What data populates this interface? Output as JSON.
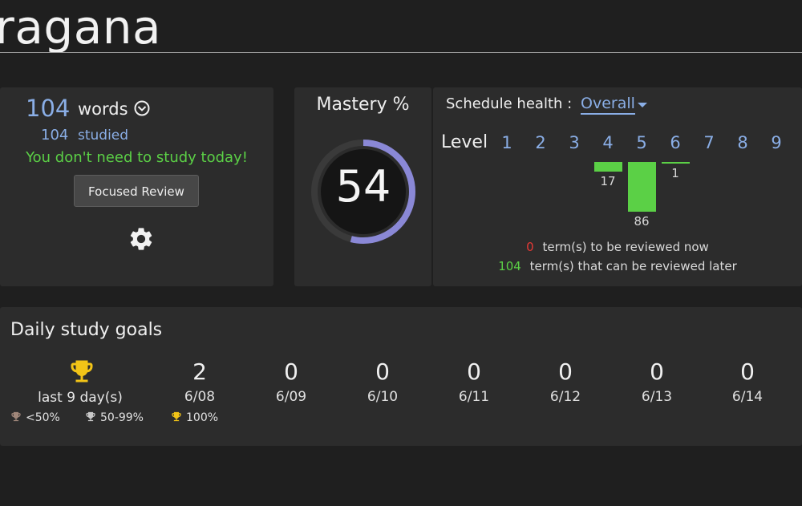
{
  "app_title": "ragana",
  "words_panel": {
    "word_count": "104",
    "word_label": "words",
    "studied_count": "104",
    "studied_label": "studied",
    "status_message": "You don't need to study today!",
    "focused_review_label": "Focused Review",
    "settings_icon": "gear-icon",
    "dropdown_icon": "chevron-down-circle-icon"
  },
  "mastery_panel": {
    "title": "Mastery %",
    "value": "54",
    "percent": 54
  },
  "schedule_panel": {
    "label": "Schedule health :",
    "selected_view": "Overall",
    "level_label": "Level",
    "levels": [
      "1",
      "2",
      "3",
      "4",
      "5",
      "6",
      "7",
      "8",
      "9"
    ],
    "level_counts": [
      0,
      0,
      0,
      17,
      86,
      1,
      0,
      0,
      0
    ],
    "bar_labels": {
      "4": "17",
      "5": "86",
      "6": "1"
    },
    "review_now_count": "0",
    "review_now_text": "term(s) to be reviewed now",
    "review_later_count": "104",
    "review_later_text": "term(s) that can be reviewed later"
  },
  "goals_panel": {
    "title": "Daily study goals",
    "streak_text": "last 9 day(s)",
    "legend": [
      {
        "label": "<50%",
        "color": "#a0877a"
      },
      {
        "label": "50-99%",
        "color": "#c9c9c9"
      },
      {
        "label": "100%",
        "color": "#f2c417"
      }
    ],
    "days": [
      {
        "value": "2",
        "date": "6/08"
      },
      {
        "value": "0",
        "date": "6/09"
      },
      {
        "value": "0",
        "date": "6/10"
      },
      {
        "value": "0",
        "date": "6/11"
      },
      {
        "value": "0",
        "date": "6/12"
      },
      {
        "value": "0",
        "date": "6/13"
      },
      {
        "value": "0",
        "date": "6/14"
      }
    ]
  },
  "colors": {
    "accent_blue": "#8aaee6",
    "success_green": "#5bd046",
    "alert_red": "#e53935",
    "ring_purple": "#8a88d6",
    "trophy_gold": "#f2c417"
  }
}
